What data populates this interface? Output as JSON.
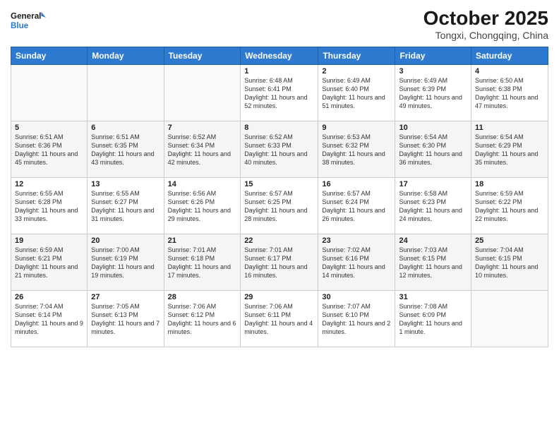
{
  "logo": {
    "line1": "General",
    "line2": "Blue"
  },
  "title": "October 2025",
  "subtitle": "Tongxi, Chongqing, China",
  "headers": [
    "Sunday",
    "Monday",
    "Tuesday",
    "Wednesday",
    "Thursday",
    "Friday",
    "Saturday"
  ],
  "weeks": [
    [
      {
        "day": "",
        "info": ""
      },
      {
        "day": "",
        "info": ""
      },
      {
        "day": "",
        "info": ""
      },
      {
        "day": "1",
        "info": "Sunrise: 6:48 AM\nSunset: 6:41 PM\nDaylight: 11 hours\nand 52 minutes."
      },
      {
        "day": "2",
        "info": "Sunrise: 6:49 AM\nSunset: 6:40 PM\nDaylight: 11 hours\nand 51 minutes."
      },
      {
        "day": "3",
        "info": "Sunrise: 6:49 AM\nSunset: 6:39 PM\nDaylight: 11 hours\nand 49 minutes."
      },
      {
        "day": "4",
        "info": "Sunrise: 6:50 AM\nSunset: 6:38 PM\nDaylight: 11 hours\nand 47 minutes."
      }
    ],
    [
      {
        "day": "5",
        "info": "Sunrise: 6:51 AM\nSunset: 6:36 PM\nDaylight: 11 hours\nand 45 minutes."
      },
      {
        "day": "6",
        "info": "Sunrise: 6:51 AM\nSunset: 6:35 PM\nDaylight: 11 hours\nand 43 minutes."
      },
      {
        "day": "7",
        "info": "Sunrise: 6:52 AM\nSunset: 6:34 PM\nDaylight: 11 hours\nand 42 minutes."
      },
      {
        "day": "8",
        "info": "Sunrise: 6:52 AM\nSunset: 6:33 PM\nDaylight: 11 hours\nand 40 minutes."
      },
      {
        "day": "9",
        "info": "Sunrise: 6:53 AM\nSunset: 6:32 PM\nDaylight: 11 hours\nand 38 minutes."
      },
      {
        "day": "10",
        "info": "Sunrise: 6:54 AM\nSunset: 6:30 PM\nDaylight: 11 hours\nand 36 minutes."
      },
      {
        "day": "11",
        "info": "Sunrise: 6:54 AM\nSunset: 6:29 PM\nDaylight: 11 hours\nand 35 minutes."
      }
    ],
    [
      {
        "day": "12",
        "info": "Sunrise: 6:55 AM\nSunset: 6:28 PM\nDaylight: 11 hours\nand 33 minutes."
      },
      {
        "day": "13",
        "info": "Sunrise: 6:55 AM\nSunset: 6:27 PM\nDaylight: 11 hours\nand 31 minutes."
      },
      {
        "day": "14",
        "info": "Sunrise: 6:56 AM\nSunset: 6:26 PM\nDaylight: 11 hours\nand 29 minutes."
      },
      {
        "day": "15",
        "info": "Sunrise: 6:57 AM\nSunset: 6:25 PM\nDaylight: 11 hours\nand 28 minutes."
      },
      {
        "day": "16",
        "info": "Sunrise: 6:57 AM\nSunset: 6:24 PM\nDaylight: 11 hours\nand 26 minutes."
      },
      {
        "day": "17",
        "info": "Sunrise: 6:58 AM\nSunset: 6:23 PM\nDaylight: 11 hours\nand 24 minutes."
      },
      {
        "day": "18",
        "info": "Sunrise: 6:59 AM\nSunset: 6:22 PM\nDaylight: 11 hours\nand 22 minutes."
      }
    ],
    [
      {
        "day": "19",
        "info": "Sunrise: 6:59 AM\nSunset: 6:21 PM\nDaylight: 11 hours\nand 21 minutes."
      },
      {
        "day": "20",
        "info": "Sunrise: 7:00 AM\nSunset: 6:19 PM\nDaylight: 11 hours\nand 19 minutes."
      },
      {
        "day": "21",
        "info": "Sunrise: 7:01 AM\nSunset: 6:18 PM\nDaylight: 11 hours\nand 17 minutes."
      },
      {
        "day": "22",
        "info": "Sunrise: 7:01 AM\nSunset: 6:17 PM\nDaylight: 11 hours\nand 16 minutes."
      },
      {
        "day": "23",
        "info": "Sunrise: 7:02 AM\nSunset: 6:16 PM\nDaylight: 11 hours\nand 14 minutes."
      },
      {
        "day": "24",
        "info": "Sunrise: 7:03 AM\nSunset: 6:15 PM\nDaylight: 11 hours\nand 12 minutes."
      },
      {
        "day": "25",
        "info": "Sunrise: 7:04 AM\nSunset: 6:15 PM\nDaylight: 11 hours\nand 10 minutes."
      }
    ],
    [
      {
        "day": "26",
        "info": "Sunrise: 7:04 AM\nSunset: 6:14 PM\nDaylight: 11 hours\nand 9 minutes."
      },
      {
        "day": "27",
        "info": "Sunrise: 7:05 AM\nSunset: 6:13 PM\nDaylight: 11 hours\nand 7 minutes."
      },
      {
        "day": "28",
        "info": "Sunrise: 7:06 AM\nSunset: 6:12 PM\nDaylight: 11 hours\nand 6 minutes."
      },
      {
        "day": "29",
        "info": "Sunrise: 7:06 AM\nSunset: 6:11 PM\nDaylight: 11 hours\nand 4 minutes."
      },
      {
        "day": "30",
        "info": "Sunrise: 7:07 AM\nSunset: 6:10 PM\nDaylight: 11 hours\nand 2 minutes."
      },
      {
        "day": "31",
        "info": "Sunrise: 7:08 AM\nSunset: 6:09 PM\nDaylight: 11 hours\nand 1 minute."
      },
      {
        "day": "",
        "info": ""
      }
    ]
  ]
}
